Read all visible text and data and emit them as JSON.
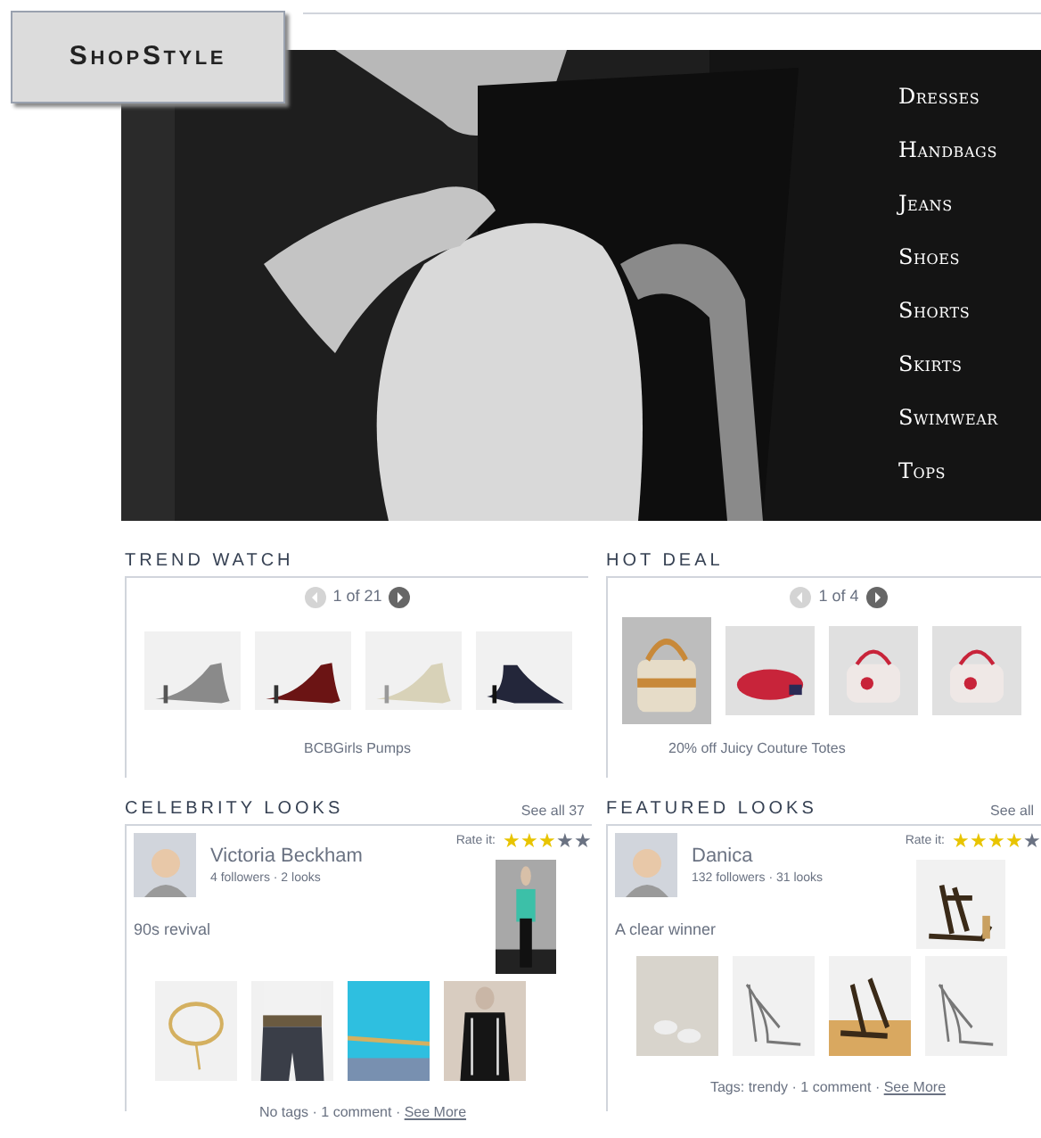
{
  "logo": "ShopStyle",
  "nav": [
    "Dresses",
    "Handbags",
    "Jeans",
    "Shoes",
    "Shorts",
    "Skirts",
    "Swimwear",
    "Tops"
  ],
  "trend_watch": {
    "title": "TREND WATCH",
    "pager": "1 of 21",
    "caption": "BCBGirls Pumps"
  },
  "hot_deal": {
    "title": "HOT DEAL",
    "pager": "1 of 4",
    "caption": "20% off Juicy Couture Totes"
  },
  "looks": [
    {
      "title": "CELEBRITY LOOKS",
      "see_all": "See all 37",
      "rate_label": "Rate it:",
      "stars": 3,
      "user": "Victoria Beckham",
      "stats": "4 followers · 2 looks",
      "look_title": "90s revival",
      "footer": "No tags · 1 comment · ",
      "link": "See More"
    },
    {
      "title": "FEATURED LOOKS",
      "see_all": "See all",
      "rate_label": "Rate it:",
      "stars": 4,
      "user": "Danica",
      "stats": "132 followers · 31 looks",
      "look_title": "A clear winner",
      "footer": "Tags: trendy · 1 comment · ",
      "link": "See More"
    }
  ]
}
